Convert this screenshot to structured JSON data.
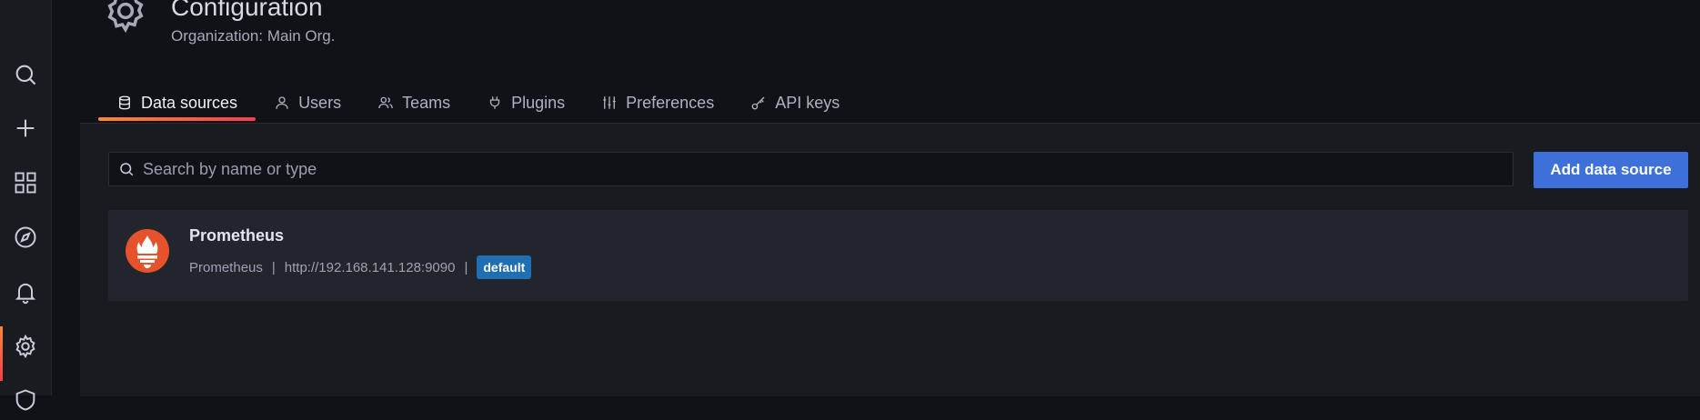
{
  "header": {
    "title": "Configuration",
    "subtitle": "Organization: Main Org."
  },
  "sidebar": {
    "items": [
      {
        "icon": "search-icon"
      },
      {
        "icon": "plus-icon"
      },
      {
        "icon": "dashboards-icon"
      },
      {
        "icon": "explore-compass-icon"
      },
      {
        "icon": "alerting-bell-icon"
      },
      {
        "icon": "configuration-gear-icon",
        "active": true
      },
      {
        "icon": "shield-icon"
      }
    ]
  },
  "tabs": [
    {
      "label": "Data sources",
      "icon": "database-icon",
      "active": true
    },
    {
      "label": "Users",
      "icon": "user-icon"
    },
    {
      "label": "Teams",
      "icon": "teams-icon"
    },
    {
      "label": "Plugins",
      "icon": "plug-icon"
    },
    {
      "label": "Preferences",
      "icon": "sliders-icon"
    },
    {
      "label": "API keys",
      "icon": "key-icon"
    }
  ],
  "search": {
    "placeholder": "Search by name or type",
    "value": ""
  },
  "actions": {
    "add_label": "Add data source"
  },
  "datasources": [
    {
      "name": "Prometheus",
      "type": "Prometheus",
      "url": "http://192.168.141.128:9090",
      "separator": "|",
      "badge": "default",
      "logo": "prometheus-logo-icon"
    }
  ],
  "colors": {
    "accent_gradient_start": "#ff8833",
    "accent_gradient_end": "#f53e4c",
    "primary_button": "#3d71d9",
    "badge": "#1f6fb5",
    "prometheus_logo": "#e6522c"
  }
}
